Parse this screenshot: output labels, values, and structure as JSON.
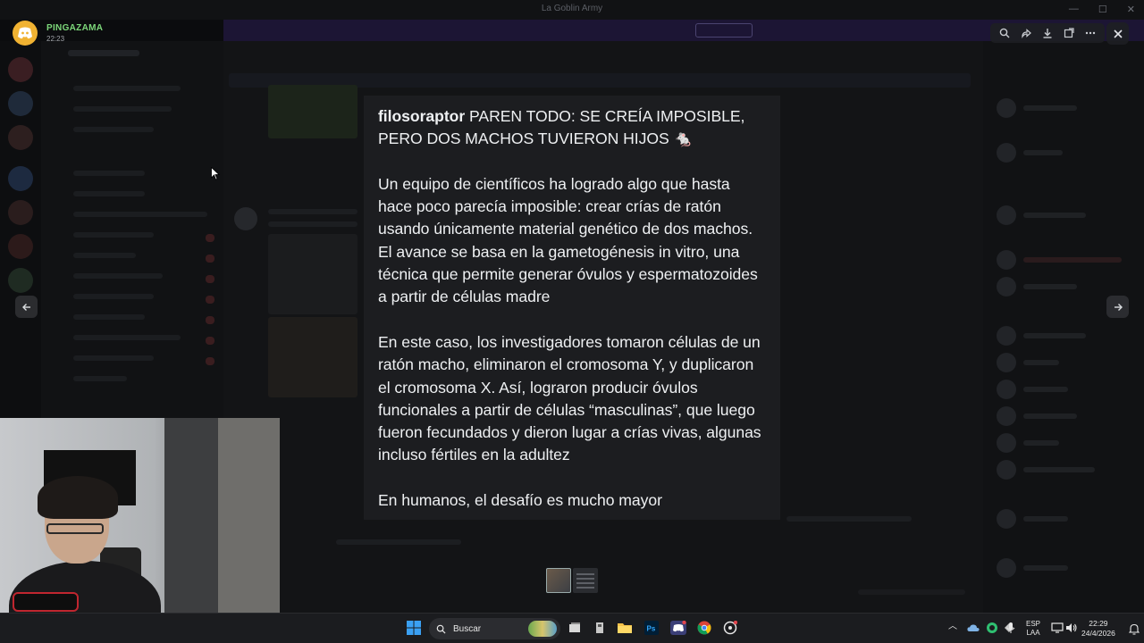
{
  "window": {
    "title": "La Goblin Army"
  },
  "viewer": {
    "uploader_name": "PINGAZAMA",
    "upload_time": "22:23",
    "tools": [
      "zoom-in-icon",
      "forward-icon",
      "download-icon",
      "open-external-icon",
      "more-icon"
    ],
    "close_icon": "close-icon",
    "prev_icon": "arrow-left-icon",
    "next_icon": "arrow-right-icon"
  },
  "post": {
    "author": "filosoraptor",
    "headline": "PAREN TODO: SE CREÍA IMPOSIBLE, PERO DOS MACHOS TUVIERON HIJOS 🐁",
    "paragraph1": "Un equipo de científicos ha logrado algo que hasta hace poco parecía imposible: crear crías de ratón usando únicamente material genético de dos machos. El avance se basa en la gametogénesis in vitro, una técnica que permite generar óvulos y espermatozoides a partir de células madre",
    "paragraph2": "En este caso, los investigadores tomaron células de un ratón macho, eliminaron el cromosoma Y, y duplicaron el cromosoma X. Así, lograron producir óvulos funcionales a partir de células “masculinas”, que luego fueron fecundados y dieron lugar a crías vivas, algunas incluso fértiles en la adultez",
    "paragraph3": "En humanos, el desafío es mucho mayor"
  },
  "taskbar": {
    "search_label": "Buscar",
    "lang_line1": "ESP",
    "lang_line2": "LAA",
    "time": "22:29",
    "date": "24/4/2026"
  },
  "colors": {
    "discord_logo": "#f0b232",
    "uploader": "#7dd87a",
    "card_bg": "#1c1d20",
    "taskbar_bg": "#1b1c1f"
  }
}
